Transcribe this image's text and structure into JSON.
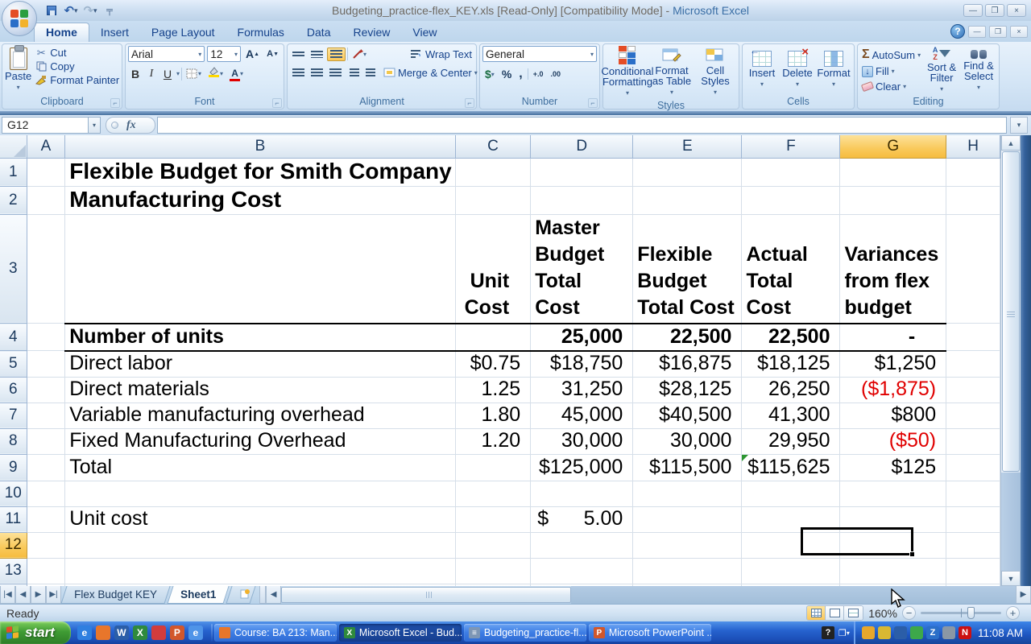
{
  "window": {
    "title_doc": "Budgeting_practice-flex_KEY.xls  [Read-Only]  [Compatibility Mode] -",
    "title_app": "Microsoft Excel"
  },
  "ribbon": {
    "tabs": [
      {
        "label": "Home",
        "active": true
      },
      {
        "label": "Insert",
        "active": false
      },
      {
        "label": "Page Layout",
        "active": false
      },
      {
        "label": "Formulas",
        "active": false
      },
      {
        "label": "Data",
        "active": false
      },
      {
        "label": "Review",
        "active": false
      },
      {
        "label": "View",
        "active": false
      }
    ],
    "clipboard": {
      "title": "Clipboard",
      "paste": "Paste",
      "cut": "Cut",
      "copy": "Copy",
      "format_painter": "Format Painter"
    },
    "font": {
      "title": "Font",
      "font_name": "Arial",
      "font_size": "12",
      "bold": "B",
      "italic": "I",
      "underline": "U",
      "grow": "A",
      "shrink": "A"
    },
    "alignment": {
      "title": "Alignment",
      "wrap_text": "Wrap Text",
      "merge_center": "Merge & Center"
    },
    "number": {
      "title": "Number",
      "format": "General",
      "currency": "$",
      "percent": "%",
      "comma": ",",
      "inc_dec": "+.0",
      "dec_dec": ".00"
    },
    "styles": {
      "title": "Styles",
      "conditional": "Conditional\nFormatting",
      "format_table": "Format\nas Table",
      "cell_styles": "Cell\nStyles"
    },
    "cells": {
      "title": "Cells",
      "insert": "Insert",
      "delete": "Delete",
      "format": "Format"
    },
    "editing": {
      "title": "Editing",
      "autosum": "AutoSum",
      "fill": "Fill",
      "clear": "Clear",
      "sigma": "Σ",
      "sort": "Sort &\nFilter",
      "find": "Find &\nSelect"
    }
  },
  "formula_bar": {
    "name_box": "G12",
    "fx": "fx",
    "formula": ""
  },
  "grid": {
    "col_headers": [
      "A",
      "B",
      "C",
      "D",
      "E",
      "F",
      "G",
      "H"
    ],
    "row_headers": [
      "1",
      "2",
      "3",
      "4",
      "5",
      "6",
      "7",
      "8",
      "9",
      "10",
      "11",
      "12",
      "13"
    ],
    "selected_col": "G",
    "selected_row": "12",
    "selected_cell": "G12",
    "cells": [
      {
        "ref": "B1",
        "text": "Flexible Budget for Smith Company",
        "cls": "t spill"
      },
      {
        "ref": "B2",
        "text": "Manufacturing Cost",
        "cls": "t spill"
      },
      {
        "ref": "B3",
        "text": "",
        "cls": "bb"
      },
      {
        "ref": "C3",
        "text": "Unit\nCost",
        "cls": "h hr bb"
      },
      {
        "ref": "D3",
        "text": "Master\nBudget\nTotal\nCost",
        "cls": "h bb"
      },
      {
        "ref": "E3",
        "text": "Flexible\nBudget\nTotal Cost",
        "cls": "h bb"
      },
      {
        "ref": "F3",
        "text": "Actual\nTotal\nCost",
        "cls": "h bb"
      },
      {
        "ref": "G3",
        "text": "Variances\nfrom flex\nbudget",
        "cls": "h bb"
      },
      {
        "ref": "B4",
        "text": "Number of units",
        "cls": "b bb"
      },
      {
        "ref": "C4",
        "text": "",
        "cls": "bb"
      },
      {
        "ref": "D4",
        "text": "25,000",
        "cls": "n b bb"
      },
      {
        "ref": "E4",
        "text": "22,500",
        "cls": "n b bb"
      },
      {
        "ref": "F4",
        "text": "22,500",
        "cls": "n b bb"
      },
      {
        "ref": "G4",
        "text": "-",
        "cls": "n b bb dash"
      },
      {
        "ref": "B5",
        "text": "Direct labor",
        "cls": ""
      },
      {
        "ref": "C5",
        "text": "$0.75",
        "cls": "n"
      },
      {
        "ref": "D5",
        "text": "$18,750",
        "cls": "n"
      },
      {
        "ref": "E5",
        "text": "$16,875",
        "cls": "n"
      },
      {
        "ref": "F5",
        "text": "$18,125",
        "cls": "n"
      },
      {
        "ref": "G5",
        "text": "$1,250",
        "cls": "n"
      },
      {
        "ref": "B6",
        "text": "Direct materials",
        "cls": ""
      },
      {
        "ref": "C6",
        "text": "1.25",
        "cls": "n"
      },
      {
        "ref": "D6",
        "text": "31,250",
        "cls": "n"
      },
      {
        "ref": "E6",
        "text": "$28,125",
        "cls": "n"
      },
      {
        "ref": "F6",
        "text": "26,250",
        "cls": "n"
      },
      {
        "ref": "G6",
        "text": "($1,875)",
        "cls": "n neg"
      },
      {
        "ref": "B7",
        "text": "Variable manufacturing overhead",
        "cls": "spill"
      },
      {
        "ref": "C7",
        "text": "1.80",
        "cls": "n"
      },
      {
        "ref": "D7",
        "text": "45,000",
        "cls": "n"
      },
      {
        "ref": "E7",
        "text": "$40,500",
        "cls": "n"
      },
      {
        "ref": "F7",
        "text": "41,300",
        "cls": "n"
      },
      {
        "ref": "G7",
        "text": "$800",
        "cls": "n"
      },
      {
        "ref": "B8",
        "text": "Fixed Manufacturing Overhead",
        "cls": "spill"
      },
      {
        "ref": "C8",
        "text": "1.20",
        "cls": "n"
      },
      {
        "ref": "D8",
        "text": "30,000",
        "cls": "n"
      },
      {
        "ref": "E8",
        "text": "30,000",
        "cls": "n"
      },
      {
        "ref": "F8",
        "text": "29,950",
        "cls": "n"
      },
      {
        "ref": "G8",
        "text": "($50)",
        "cls": "n neg"
      },
      {
        "ref": "B9",
        "text": "Total",
        "cls": ""
      },
      {
        "ref": "D9",
        "text": "$125,000",
        "cls": "n"
      },
      {
        "ref": "E9",
        "text": "$115,500",
        "cls": "n"
      },
      {
        "ref": "F9",
        "text": "$115,625",
        "cls": "n flag"
      },
      {
        "ref": "G9",
        "text": "$125",
        "cls": "n"
      },
      {
        "ref": "B11",
        "text": "Unit cost",
        "cls": ""
      },
      {
        "ref": "D11",
        "cur": "$",
        "text": "5.00",
        "cls": "acct"
      }
    ]
  },
  "sheet_tabs": {
    "tabs": [
      {
        "label": "Flex Budget KEY",
        "active": false
      },
      {
        "label": "Sheet1",
        "active": true
      }
    ]
  },
  "status_bar": {
    "mode": "Ready",
    "zoom": "160%"
  },
  "taskbar": {
    "start_label": "start",
    "tasks": [
      {
        "label": "Course: BA 213: Man...",
        "app": "firefox",
        "active": false
      },
      {
        "label": "Microsoft Excel - Bud...",
        "app": "excel",
        "active": true
      },
      {
        "label": "Budgeting_practice-fl...",
        "app": "document",
        "active": false
      },
      {
        "label": "Microsoft PowerPoint ...",
        "app": "powerpoint",
        "active": false
      }
    ],
    "quick_launch": [
      {
        "name": "quick-launch-internet-explorer",
        "glyph": "e",
        "color": "#2f7fe0"
      },
      {
        "name": "quick-launch-firefox",
        "glyph": "",
        "color": "#e8762b"
      },
      {
        "name": "quick-launch-word",
        "glyph": "W",
        "color": "#2b5ea8"
      },
      {
        "name": "quick-launch-excel",
        "glyph": "X",
        "color": "#2f8a3d"
      },
      {
        "name": "quick-launch-keys",
        "glyph": "",
        "color": "#d23c3c"
      },
      {
        "name": "quick-launch-powerpoint",
        "glyph": "P",
        "color": "#d2572b"
      },
      {
        "name": "quick-launch-ie-doc",
        "glyph": "e",
        "color": "#4f94e8"
      }
    ],
    "tray": [
      {
        "name": "tray-icon-agent",
        "glyph": "",
        "color": "#e8a72b"
      },
      {
        "name": "tray-icon-shield",
        "glyph": "",
        "color": "#d8b832"
      },
      {
        "name": "tray-icon-tools",
        "glyph": "",
        "color": "#2b5ea8"
      },
      {
        "name": "tray-icon-green",
        "glyph": "",
        "color": "#3da84a"
      },
      {
        "name": "tray-icon-z",
        "glyph": "Z",
        "color": "#2b6fc8"
      },
      {
        "name": "tray-icon-volume",
        "glyph": "",
        "color": "#8a97a5"
      },
      {
        "name": "tray-icon-norton",
        "glyph": "N",
        "color": "#cc1111"
      }
    ],
    "clock": "11:08 AM"
  }
}
